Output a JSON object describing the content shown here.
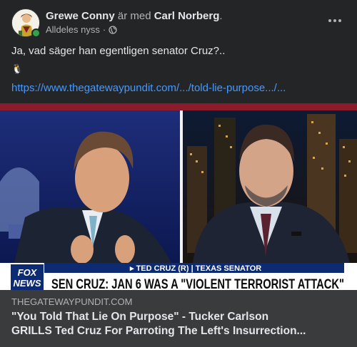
{
  "post": {
    "author": "Grewe Conny",
    "with_text": "är med",
    "tagged": "Carl Norberg",
    "period": ".",
    "timestamp": "Alldeles nyss",
    "separator": "·",
    "privacy_icon": "globe-icon",
    "more_icon": "more-horizontal-icon",
    "body": "Ja, vad säger han egentligen senator Cruz?..",
    "emoji": "🐧",
    "link_text": "https://www.thegatewaypundit.com/.../told-lie-purpose.../..."
  },
  "preview": {
    "lower_third": {
      "name_bar": "▸ TED CRUZ (R) | TEXAS SENATOR",
      "headline": "SEN CRUZ: JAN 6 WAS A \"VIOLENT TERRORIST ATTACK\"",
      "network_logo_line1": "FOX",
      "network_logo_line2": "NEWS"
    },
    "domain": "THEGATEWAYPUNDIT.COM",
    "title_line1": "\"You Told That Lie On Purpose\" - Tucker Carlson",
    "title_line2": "GRILLS Ted Cruz For Parroting The Left's Insurrection..."
  },
  "colors": {
    "card_bg": "#242526",
    "caption_bg": "#3a3b3c",
    "link": "#4599ff",
    "online": "#31a24c",
    "fox_blue": "#0d2b73"
  }
}
